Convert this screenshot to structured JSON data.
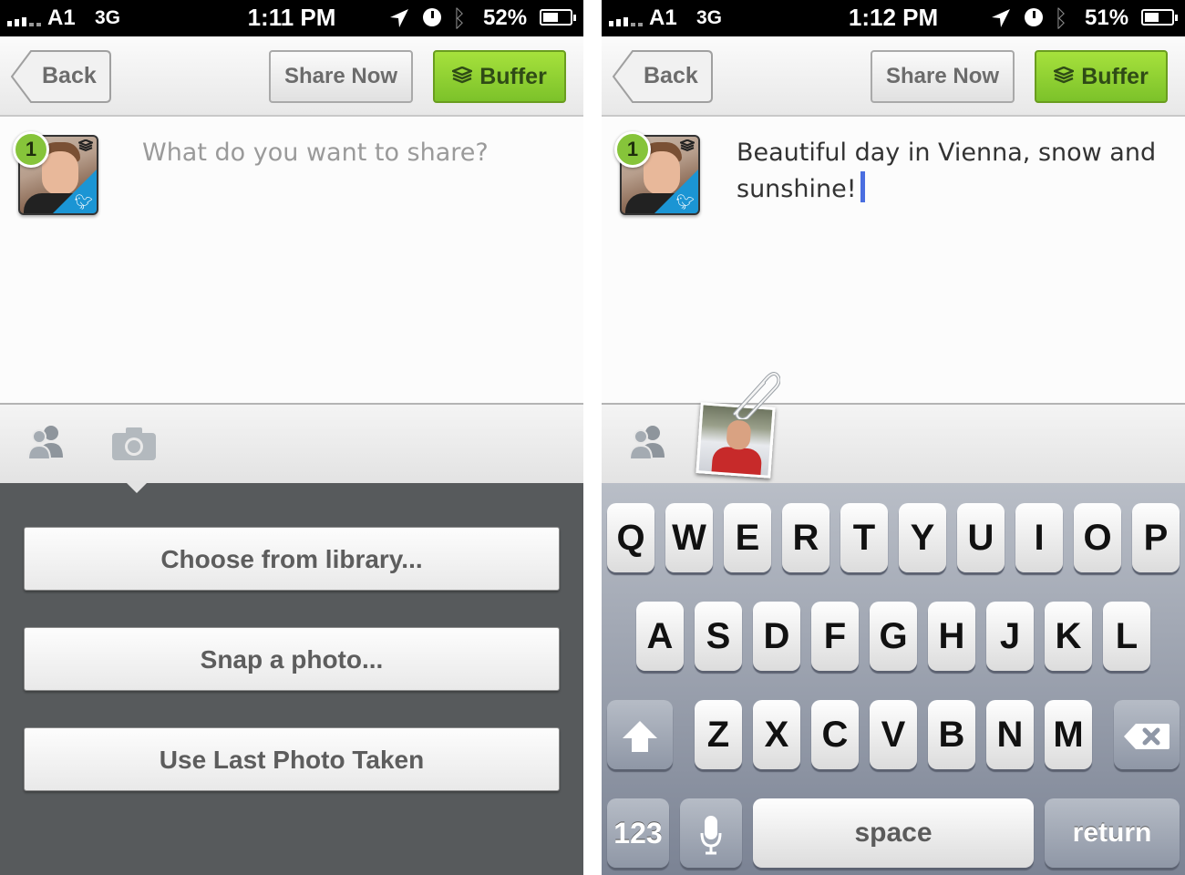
{
  "screens": [
    {
      "status": {
        "carrier": "A1",
        "network": "3G",
        "time": "1:11 PM",
        "battery": "52%",
        "battery_level": 0.52
      },
      "nav": {
        "back": "Back",
        "share_now": "Share Now",
        "buffer": "Buffer"
      },
      "profile": {
        "badge": "1"
      },
      "compose": {
        "placeholder": "What do you want to share?"
      },
      "photo_menu": {
        "items": [
          "Choose from library...",
          "Snap a photo...",
          "Use Last Photo Taken"
        ]
      }
    },
    {
      "status": {
        "carrier": "A1",
        "network": "3G",
        "time": "1:12 PM",
        "battery": "51%",
        "battery_level": 0.51
      },
      "nav": {
        "back": "Back",
        "share_now": "Share Now",
        "buffer": "Buffer"
      },
      "profile": {
        "badge": "1"
      },
      "compose": {
        "text": "Beautiful day in Vienna, snow and sunshine!"
      },
      "keyboard": {
        "row1": [
          "Q",
          "W",
          "E",
          "R",
          "T",
          "Y",
          "U",
          "I",
          "O",
          "P"
        ],
        "row2": [
          "A",
          "S",
          "D",
          "F",
          "G",
          "H",
          "J",
          "K",
          "L"
        ],
        "row3": [
          "Z",
          "X",
          "C",
          "V",
          "B",
          "N",
          "M"
        ],
        "numbers": "123",
        "space": "space",
        "return": "return"
      }
    }
  ],
  "icons": {
    "signal": "signal-bars-icon",
    "location": "location-arrow-icon",
    "alarm": "clock-icon",
    "bluetooth": "bluetooth-icon",
    "battery": "battery-icon",
    "buffer_stack": "buffer-stack-icon",
    "twitter": "twitter-bird-icon",
    "people": "people-icon",
    "camera": "camera-icon",
    "paperclip": "paperclip-icon",
    "shift": "shift-arrow-icon",
    "delete": "backspace-icon",
    "microphone": "microphone-icon"
  },
  "colors": {
    "buffer_green": "#8ed132",
    "badge_green": "#86c43a",
    "twitter_blue": "#1b95d4",
    "caret_blue": "#4a6ee0",
    "menu_bg": "#575a5c"
  }
}
